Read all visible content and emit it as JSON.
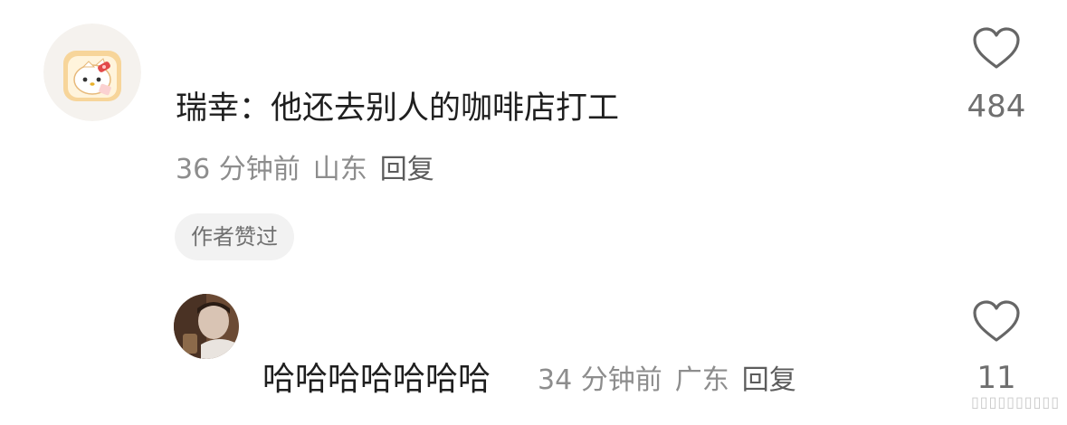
{
  "comments": [
    {
      "author": "",
      "text": "瑞幸：他还去别人的咖啡店打工",
      "time": "36 分钟前",
      "location": "山东",
      "reply_label": "回复",
      "badge": "作者赞过",
      "likes": "484",
      "avatar_icon": "hello-kitty-toast-avatar"
    },
    {
      "author": "",
      "text": "哈哈哈哈哈哈哈",
      "time": "34 分钟前",
      "location": "广东",
      "reply_label": "回复",
      "likes": "11",
      "avatar_icon": "photo-avatar"
    }
  ],
  "watermark": "▯▯▯▯▯▯▯▯▯▯",
  "colors": {
    "text": "#1f1f1f",
    "meta": "#8d8d8d",
    "like_icon": "#666666",
    "badge_bg": "#f2f2f2"
  }
}
